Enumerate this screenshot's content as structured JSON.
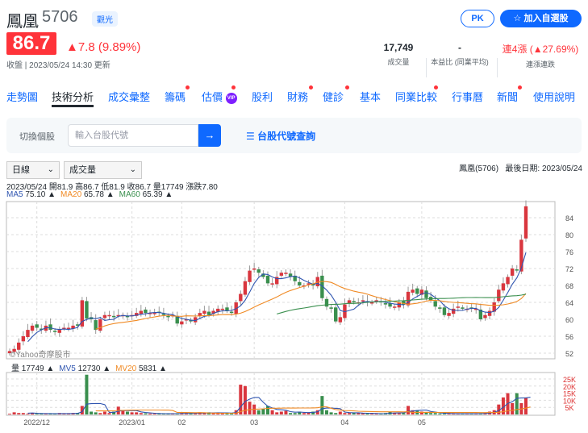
{
  "header": {
    "name": "鳳凰",
    "code": "5706",
    "sector_badge": "觀光",
    "pk_button": "PK",
    "add_watchlist_button": "加入自選股",
    "star_icon": "star-icon"
  },
  "quote": {
    "price": "86.7",
    "change": "▲7.8 (9.89%)",
    "update_label": "收盤 | 2023/05/24 14:30 更新",
    "stats": [
      {
        "value": "17,749",
        "label": "成交量"
      },
      {
        "value": "-",
        "label": "本益比 (同業平均)"
      },
      {
        "value": "連4漲 (▲27.69%)",
        "label": "連漲連跌"
      }
    ]
  },
  "tabs": [
    {
      "label": "走勢圖"
    },
    {
      "label": "技術分析",
      "active": true
    },
    {
      "label": "成交彙整"
    },
    {
      "label": "籌碼",
      "dot": true
    },
    {
      "label": "估價",
      "dot": true,
      "vip": "VIP"
    },
    {
      "label": "股利"
    },
    {
      "label": "財務",
      "dot": true
    },
    {
      "label": "健診",
      "dot": true
    },
    {
      "label": "基本"
    },
    {
      "label": "同業比較",
      "dot": true
    },
    {
      "label": "行事曆"
    },
    {
      "label": "新聞",
      "dot": true
    },
    {
      "label": "使用說明"
    }
  ],
  "search": {
    "label": "切換個股",
    "placeholder": "輸入台股代號",
    "go_icon": "arrow-right-icon",
    "lookup_link": "☰ 台股代號查詢"
  },
  "chart_controls": {
    "period": "日線",
    "indicator": "成交量",
    "title": "鳳凰(5706)   最後日期: 2023/05/24",
    "ohlc_line": "2023/05/24 開81.9 高86.7 低81.9 收86.7 量17749 漲跌7.80",
    "ma": [
      {
        "label": "MA5",
        "value": "75.10 ▲",
        "color": "#2f55b0"
      },
      {
        "label": "MA20",
        "value": "65.78 ▲",
        "color": "#f08a24"
      },
      {
        "label": "MA60",
        "value": "65.39 ▲",
        "color": "#3a8f4e"
      }
    ],
    "vol_line": [
      {
        "label": "量",
        "value": "17749 ▲",
        "color": "#232a31"
      },
      {
        "label": "MV5",
        "value": "12730 ▲",
        "color": "#2f55b0"
      },
      {
        "label": "MV20",
        "value": "5831 ▲",
        "color": "#f08a24"
      }
    ],
    "watermark": "©Yahoo奇摩股市"
  },
  "chart_data": {
    "type": "candlestick",
    "price_ticks": [
      52,
      56,
      60,
      64,
      68,
      72,
      76,
      80,
      84
    ],
    "price_range": [
      51,
      88
    ],
    "vol_ticks": [
      "5K",
      "10K",
      "15K",
      "20K",
      "25K"
    ],
    "x_labels": [
      {
        "label": "2022/12",
        "i": 6
      },
      {
        "label": "2023/01",
        "i": 27
      },
      {
        "label": "02",
        "i": 38
      },
      {
        "label": "03",
        "i": 54
      },
      {
        "label": "04",
        "i": 74
      },
      {
        "label": "05",
        "i": 91
      }
    ],
    "closes": [
      52.5,
      53,
      54.5,
      56,
      57.5,
      58.5,
      58,
      57.5,
      58.5,
      57.5,
      57,
      57.5,
      58,
      58,
      58.5,
      58.5,
      64.5,
      60.2,
      60,
      57.5,
      60,
      61,
      61,
      60.5,
      61,
      61,
      60.5,
      61,
      61.5,
      62,
      61.5,
      61.5,
      61.5,
      61.5,
      61,
      60.5,
      61,
      59,
      59.5,
      60,
      59.5,
      60.5,
      61.5,
      62,
      61,
      62,
      62.5,
      62.5,
      62,
      61.5,
      64,
      66,
      69,
      71.5,
      72,
      71,
      70,
      68.5,
      68.5,
      70,
      71,
      71,
      70,
      69,
      68,
      68,
      68.5,
      68,
      70,
      65,
      63,
      62.5,
      59.5,
      60.5,
      63.5,
      64.5,
      64,
      64,
      64.5,
      64,
      64,
      64.5,
      64,
      63.5,
      63,
      63,
      64,
      63.5,
      66.5,
      67,
      66,
      67,
      65,
      64.5,
      63,
      62.5,
      61,
      61.5,
      62.5,
      63,
      62.5,
      62.5,
      62.5,
      62.5,
      60,
      61,
      62,
      64,
      67,
      68.5,
      70,
      72,
      71.5,
      78.8,
      86.7
    ],
    "volumes_k": [
      0.5,
      1.5,
      1,
      1,
      0.5,
      1,
      0.5,
      0.5,
      0.5,
      0.5,
      0.5,
      1,
      0.5,
      0.5,
      1,
      1,
      6,
      28,
      2,
      1.5,
      1,
      2,
      1,
      2,
      5.5,
      3,
      2,
      1.5,
      1.5,
      1,
      0.8,
      0.6,
      0.5,
      0.5,
      0.5,
      0.5,
      0.6,
      0.8,
      1,
      0.8,
      0.6,
      0.8,
      1.5,
      1,
      1.5,
      1,
      1,
      0.8,
      1,
      1,
      3,
      21,
      20,
      9,
      7,
      3,
      4,
      6,
      3,
      1.5,
      2,
      2.5,
      1,
      1,
      2,
      1,
      1.5,
      2,
      3,
      13,
      3,
      1.5,
      1,
      2,
      1,
      1,
      1,
      1,
      0.8,
      0.6,
      0.5,
      0.5,
      0.5,
      1,
      2,
      1,
      0.8,
      1,
      6,
      3,
      3,
      2,
      1.5,
      1,
      1,
      0.6,
      0.5,
      0.5,
      0.5,
      0.5,
      0.5,
      0.5,
      0.5,
      0.5,
      0.8,
      1,
      2,
      3,
      7,
      12,
      15,
      8,
      15,
      8,
      12,
      17.7
    ]
  }
}
